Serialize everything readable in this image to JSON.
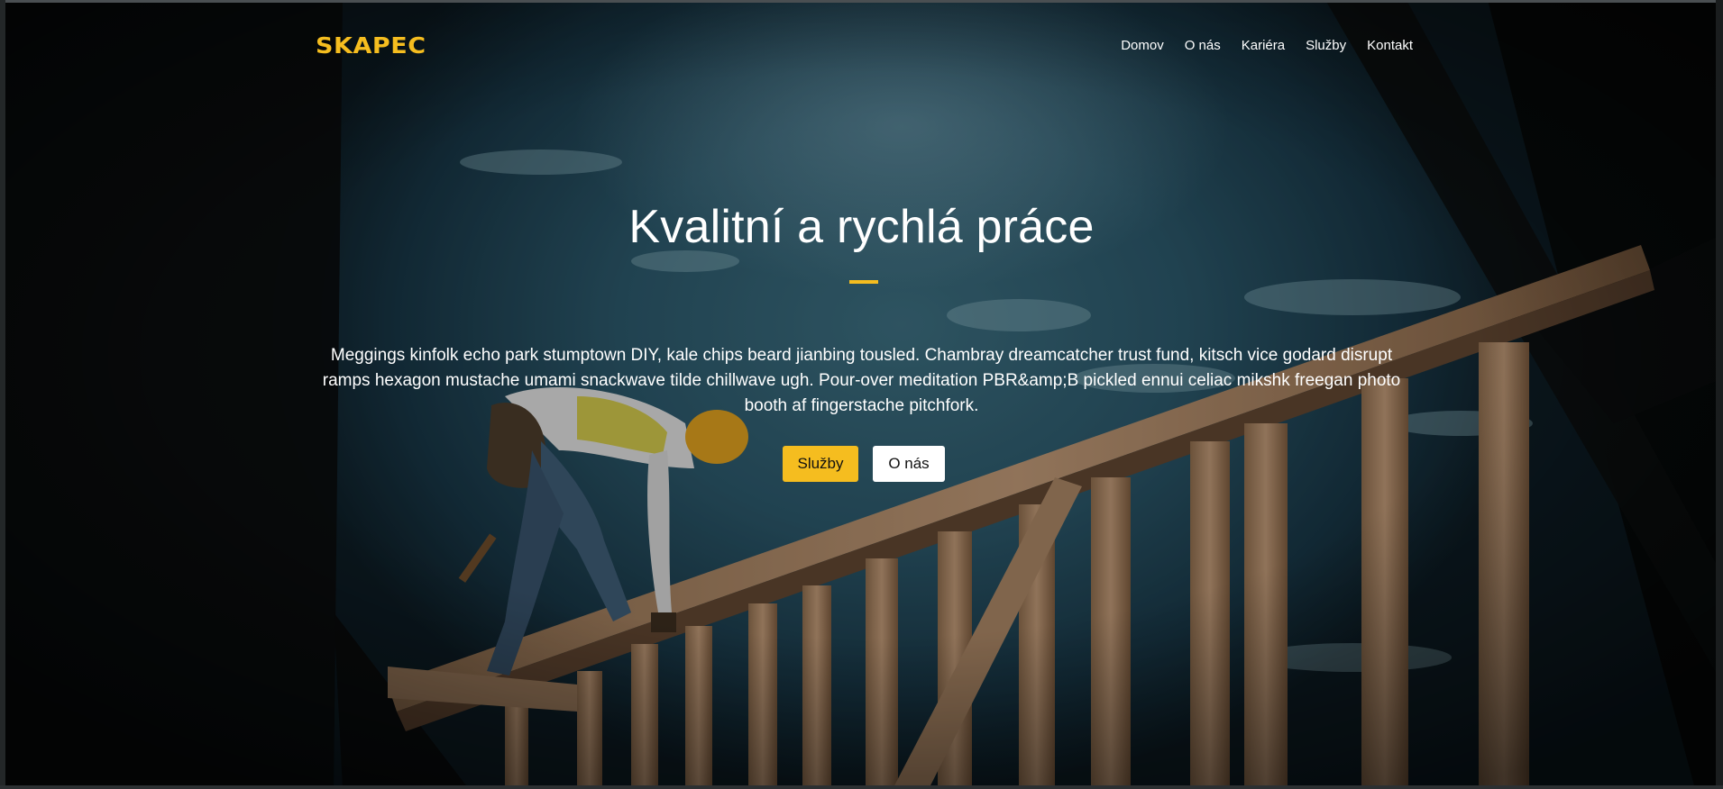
{
  "brand": {
    "logo_text": "SKAPEC",
    "accent_color": "#f5bd1f"
  },
  "nav": {
    "items": [
      {
        "label": "Domov"
      },
      {
        "label": "O nás"
      },
      {
        "label": "Kariéra"
      },
      {
        "label": "Služby"
      },
      {
        "label": "Kontakt"
      }
    ]
  },
  "hero": {
    "title": "Kvalitní a rychlá práce",
    "text": "Meggings kinfolk echo park stumptown DIY, kale chips beard jianbing tousled. Chambray dreamcatcher trust fund, kitsch vice godard disrupt ramps hexagon mustache umami snackwave tilde chillwave ugh. Pour-over meditation PBR&amp;B pickled ennui celiac mikshk freegan photo booth af fingerstache pitchfork.",
    "primary_button": "Služby",
    "secondary_button": "O nás",
    "background_image": "construction worker on wooden roof frame against blue sky"
  }
}
